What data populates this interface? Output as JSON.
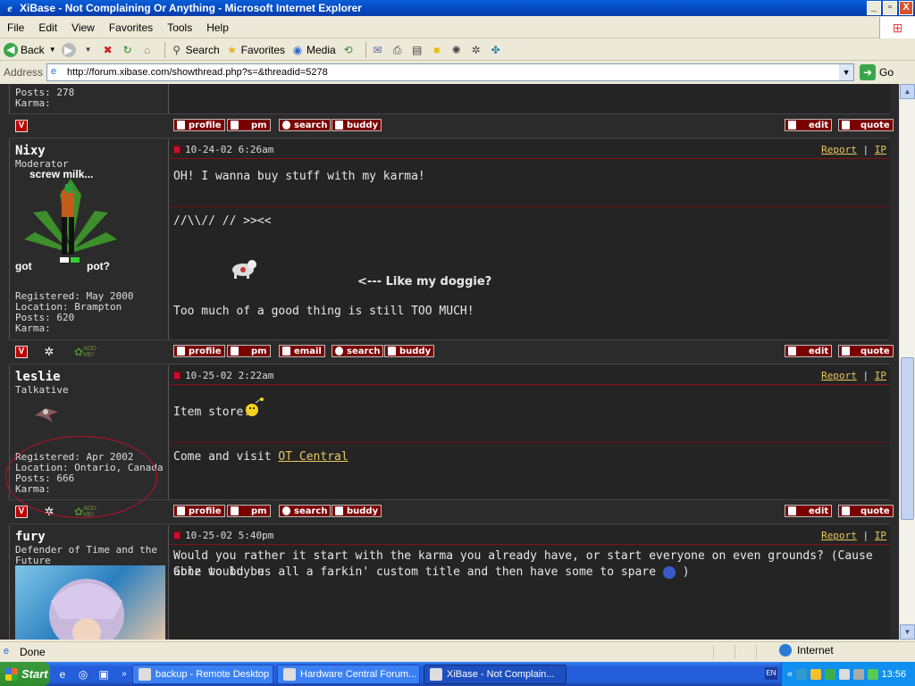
{
  "window": {
    "title": "XiBase - Not Complaining Or Anything - Microsoft Internet Explorer",
    "min": "_",
    "max": "▫",
    "close": "X"
  },
  "menu": [
    "File",
    "Edit",
    "View",
    "Favorites",
    "Tools",
    "Help"
  ],
  "toolbar": {
    "back": "Back",
    "search": "Search",
    "favorites": "Favorites",
    "media": "Media"
  },
  "address": {
    "label": "Address",
    "url": "http://forum.xibase.com/showthread.php?s=&threadid=5278",
    "go": "Go"
  },
  "prev_post": {
    "stat1": "Posts: 278",
    "stat2": "Karma:",
    "buttons": {
      "profile": "profile",
      "pm": "pm",
      "search": "search",
      "buddy": "buddy",
      "edit": "edit",
      "quote": "quote"
    }
  },
  "posts": [
    {
      "username": "Nixy",
      "usertitle": "Moderator",
      "avatar_top": "screw milk...",
      "avatar_left": "got",
      "avatar_right": "pot?",
      "registered": "Registered: May 2000",
      "location": "Location: Brampton",
      "posts": "Posts: 620",
      "karma": "Karma:",
      "date": "10-24-02 6:26am",
      "report": "Report",
      "ip": "IP",
      "body1": "OH! I wanna buy stuff with my karma!",
      "sig1": "//\\\\// // >><<",
      "sig2": "<--- Like my doggie?",
      "sig3": "Too much of a good thing is still TOO MUCH!",
      "buttons": {
        "profile": "profile",
        "pm": "pm",
        "email": "email",
        "search": "search",
        "buddy": "buddy",
        "edit": "edit",
        "quote": "quote"
      },
      "addme": "ADD ME!"
    },
    {
      "username": "leslie",
      "usertitle": "Talkative",
      "registered": "Registered: Apr 2002",
      "location": "Location: Ontario, Canada",
      "posts": "Posts: 666",
      "karma": "Karma:",
      "date": "10-25-02 2:22am",
      "report": "Report",
      "ip": "IP",
      "body1": "Item store!",
      "sig_prefix": "Come and visit ",
      "sig_link": "OT Central",
      "buttons": {
        "profile": "profile",
        "pm": "pm",
        "search": "search",
        "buddy": "buddy",
        "edit": "edit",
        "quote": "quote"
      },
      "addme": "ADD ME!"
    },
    {
      "username": "fury",
      "usertitle1": "Defender of Time and the",
      "usertitle2": "Future",
      "date": "10-25-02 5:40pm",
      "report": "Report",
      "ip": "IP",
      "body1": "Would you rather it start with the karma you already have, or start everyone on even grounds? (Cause Gonz would be",
      "body2": "able to buy us all a farkin' custom title and then have some to spare",
      "body2_end": ")"
    }
  ],
  "status": {
    "text": "Done",
    "zone": "Internet"
  },
  "taskbar": {
    "start": "Start",
    "tasks": [
      "backup - Remote Desktop",
      "Hardware Central Forum...",
      "XiBase - Not Complain..."
    ],
    "lang": "EN",
    "clock": "13:56"
  }
}
